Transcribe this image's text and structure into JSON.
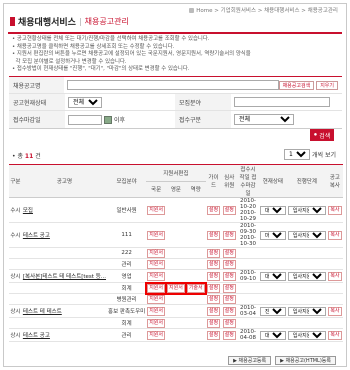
{
  "breadcrumb": {
    "items": [
      "Home",
      "기업회원서비스",
      "채용대행서비스",
      "채용공고관리"
    ],
    "sep": " > "
  },
  "header": {
    "title": "채용대행서비스",
    "subtitle": "채용공고관리"
  },
  "notes": [
    "공고현황상태를 전체 또는 대기/진행/마감을 선택하여 채용공고를 조회할 수 있습니다.",
    "채용공고명을 클릭하면 채용공고를 상세조회 또는 수정할 수 있습니다.",
    "지원서 편집란의 버튼을 누르면 채용공고에 설정되어 있는 국문지원서, 영문지원서, 역량기술서의 양식을",
    "각 모집 분야별로 설정하거나 변경할 수 있습니다.",
    "접수방법이 현재상태를 \"진행\", \"대기\", \"마감\"의 상태로 변경할 수 있습니다."
  ],
  "search": {
    "title_label": "채용공고명",
    "title_value": "",
    "search_btn": "채용공고검색",
    "clear_btn": "지우기",
    "status_label": "공고현재상태",
    "status_value": "전체",
    "field_label": "모집분야",
    "field_value": "",
    "date_label": "접수마감일",
    "date_value": "",
    "date_suffix": "이후",
    "type_label": "접수구분",
    "type_value": "전체",
    "submit": "검색"
  },
  "list": {
    "total_label": "총",
    "total": "11",
    "total_unit": "건",
    "per_page": "10",
    "per_page_suffix": "개씩 보기"
  },
  "headers": {
    "type": "구분",
    "title": "공고명",
    "field": "모집분야",
    "editor": "지원서편집",
    "ko": "국문",
    "en": "영문",
    "skill": "역량",
    "guide": "가이드",
    "review": "심사위원",
    "period": "접수시작일 접수마감일",
    "status": "현재상태",
    "stage": "진행단계",
    "notice": "공고복사"
  },
  "labels": {
    "apply": "지원서",
    "set": "설정",
    "copy": "복사",
    "skill_doc": "기술서"
  },
  "rows": [
    {
      "type": "수시",
      "title": "모집",
      "field": "일반사원",
      "period": "2010-10-20 2010-10-29",
      "status": "대기",
      "stage": "입사지원"
    },
    {
      "type": "수시",
      "title": "테스트 공고",
      "field": "111",
      "period": "2010-09-30 2010-10-30",
      "status": "마감",
      "stage": "입사지원"
    },
    {
      "type": "",
      "title": "",
      "field": "222",
      "period": "",
      "status": "",
      "stage": ""
    },
    {
      "type": "",
      "title": "",
      "field": "관리",
      "period": "",
      "status": "",
      "stage": ""
    },
    {
      "type": "상시",
      "title": "[복사본]테스트 테 테스트[test 등...",
      "field": "영업",
      "period": "2010-09-10",
      "status": "대기",
      "stage": "입사지원"
    },
    {
      "type": "",
      "title": "",
      "field": "회계",
      "period": "",
      "status": "",
      "stage": ""
    },
    {
      "type": "",
      "title": "",
      "field": "병원관리",
      "period": "",
      "status": "",
      "stage": ""
    },
    {
      "type": "상시",
      "title": "테스트 테 테스트",
      "field": "홍보 판촉도우미",
      "period": "2010-03-04",
      "status": "진행",
      "stage": "입사지원"
    },
    {
      "type": "",
      "title": "",
      "field": "회계",
      "period": "",
      "status": "",
      "stage": ""
    },
    {
      "type": "상시",
      "title": "테스트 공고",
      "field": "관리",
      "period": "2010-04-08",
      "status": "대기",
      "stage": "입사지원"
    }
  ],
  "bottom": {
    "register": "채용공고등록",
    "register_html": "채용공고(HTML)등록"
  }
}
